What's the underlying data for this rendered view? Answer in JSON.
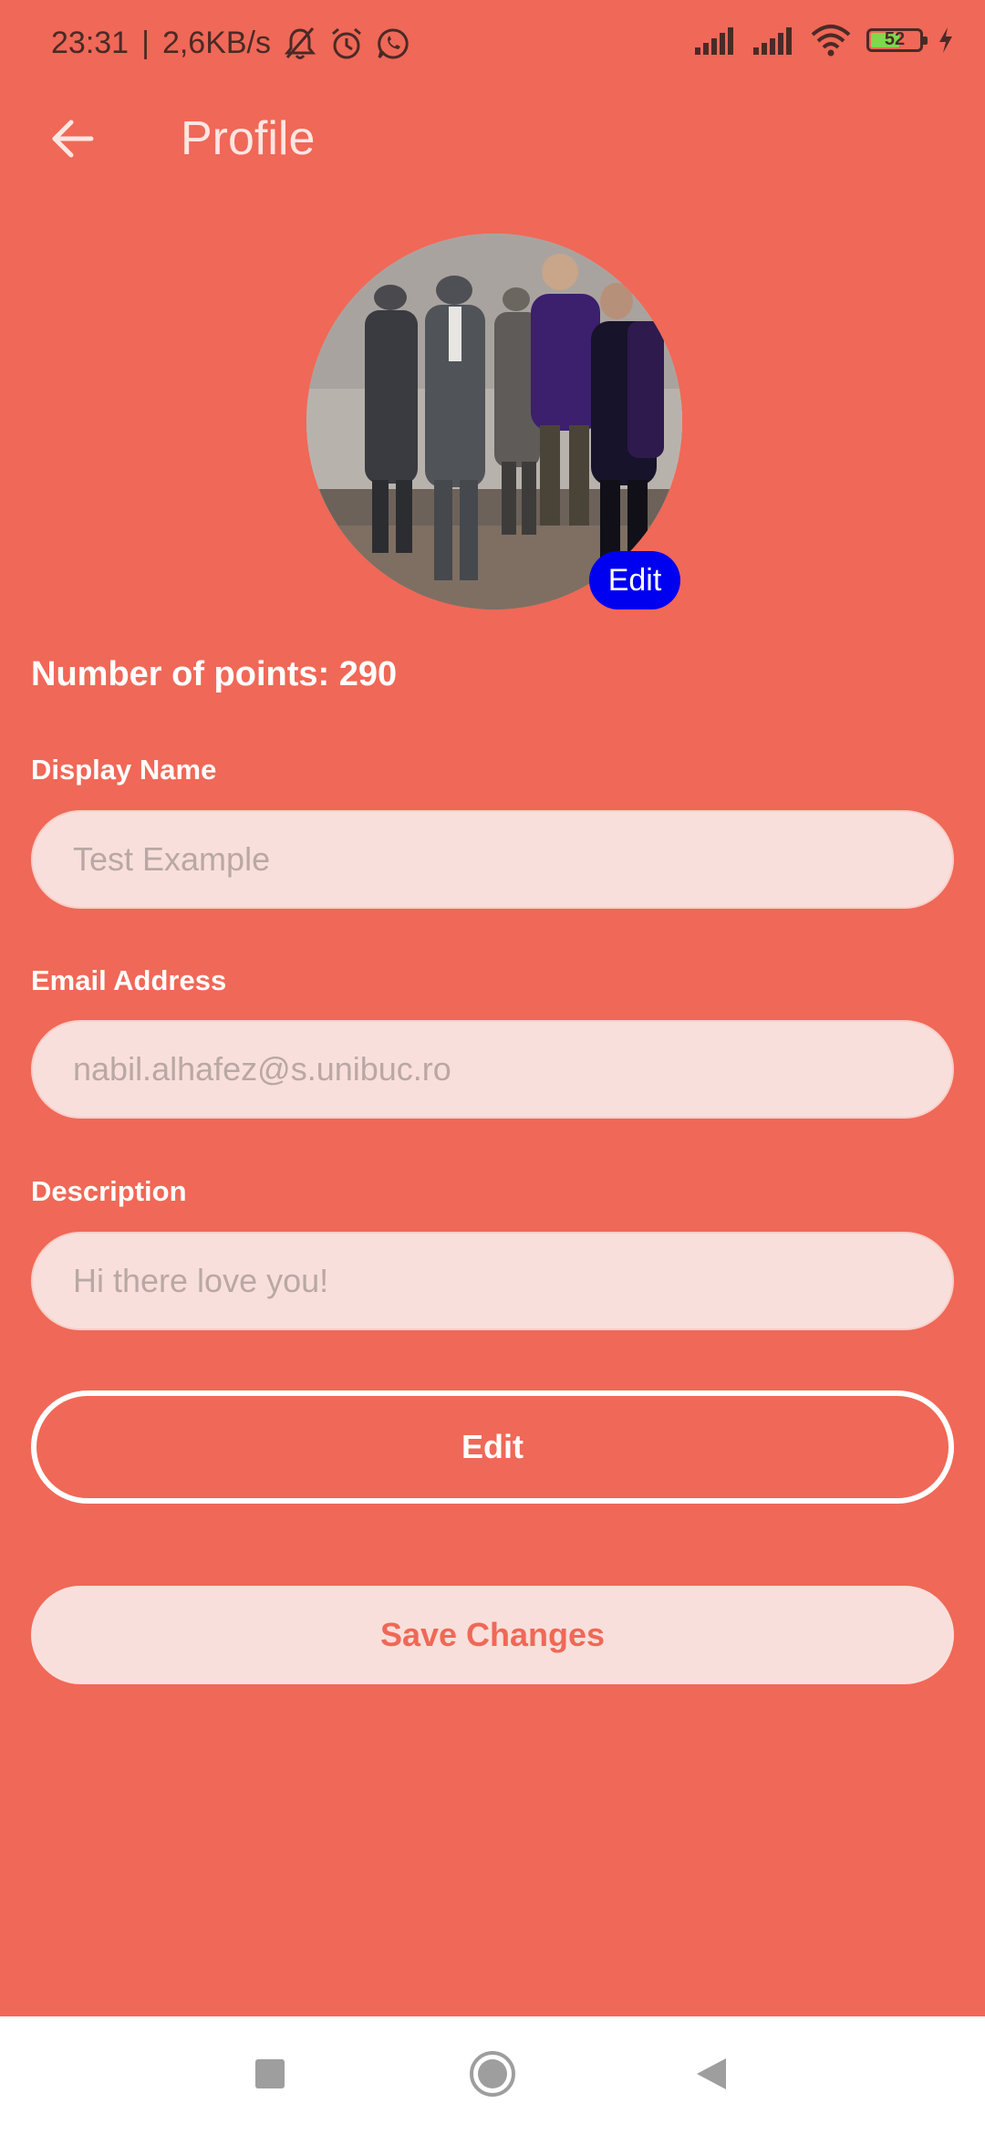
{
  "status_bar": {
    "time": "23:31",
    "separator": "|",
    "network_speed": "2,6KB/s",
    "battery_level": "52",
    "icons": [
      "muted-bell-icon",
      "alarm-icon",
      "whatsapp-icon",
      "signal-icon",
      "signal-icon",
      "wifi-icon",
      "battery-icon",
      "charging-icon"
    ]
  },
  "app_bar": {
    "title": "Profile",
    "back_icon": "arrow-left-icon"
  },
  "avatar": {
    "edit_label": "Edit"
  },
  "profile": {
    "points_text": "Number of points: 290"
  },
  "form": {
    "display_name": {
      "label": "Display Name",
      "placeholder": "Test Example",
      "value": ""
    },
    "email": {
      "label": "Email Address",
      "placeholder": "nabil.alhafez@s.unibuc.ro",
      "value": ""
    },
    "description": {
      "label": "Description",
      "placeholder": "Hi there love you!",
      "value": ""
    }
  },
  "actions": {
    "edit_label": "Edit",
    "save_label": "Save Changes"
  },
  "nav_bar": {
    "icons": [
      "square-icon",
      "circle-home-icon",
      "triangle-back-icon"
    ]
  },
  "colors": {
    "background": "#F06857",
    "field_background": "#F9DFDB",
    "avatar_edit_background": "#0000F0",
    "text_light": "#FFFFFF"
  }
}
